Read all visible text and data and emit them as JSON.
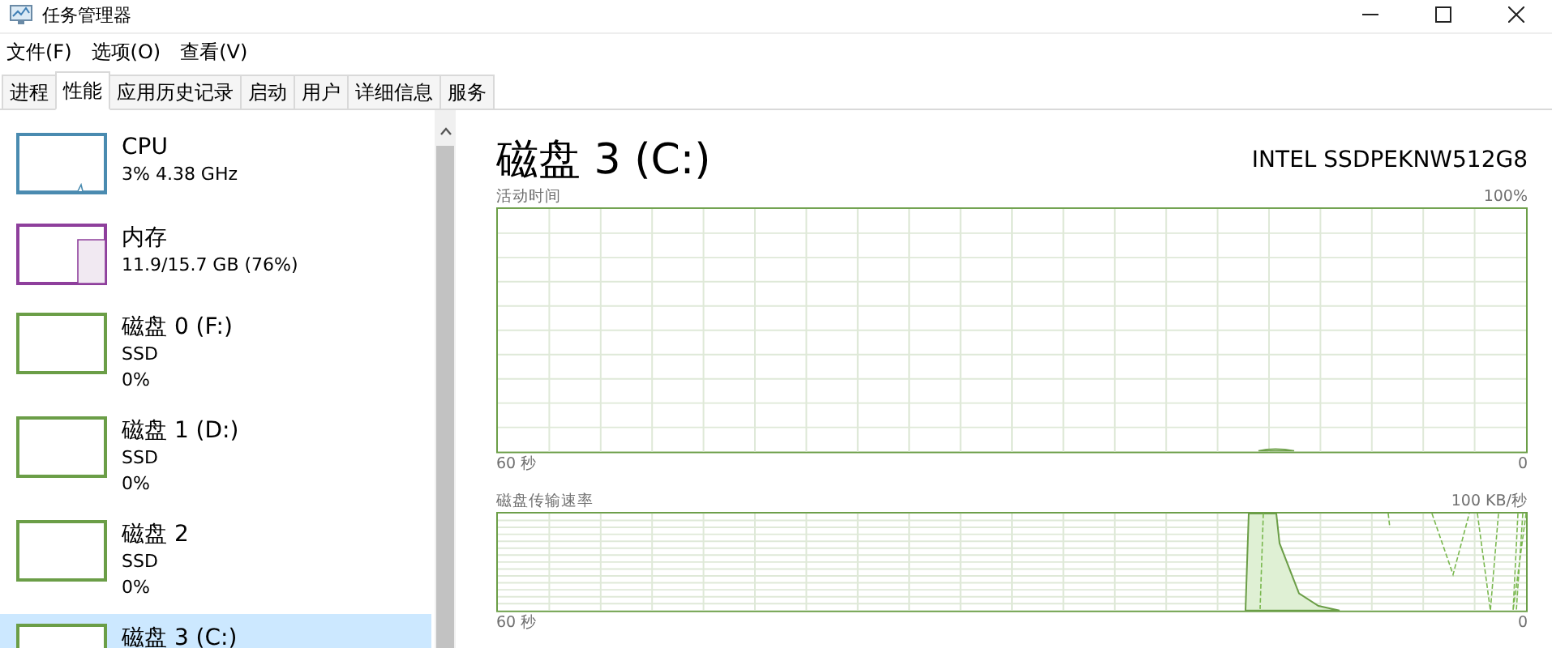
{
  "window": {
    "title": "任务管理器"
  },
  "menu": [
    "文件(F)",
    "选项(O)",
    "查看(V)"
  ],
  "tabs": [
    {
      "label": "进程",
      "selected": false
    },
    {
      "label": "性能",
      "selected": true
    },
    {
      "label": "应用历史记录",
      "selected": false
    },
    {
      "label": "启动",
      "selected": false
    },
    {
      "label": "用户",
      "selected": false
    },
    {
      "label": "详细信息",
      "selected": false
    },
    {
      "label": "服务",
      "selected": false
    }
  ],
  "sidebar": {
    "items": [
      {
        "kind": "cpu",
        "title": "CPU",
        "lines": [
          "3% 4.38 GHz"
        ],
        "color": "#4a8bb0",
        "selected": false
      },
      {
        "kind": "memory",
        "title": "内存",
        "lines": [
          "11.9/15.7 GB (76%)"
        ],
        "color": "#8e3f9c",
        "selected": false
      },
      {
        "kind": "disk",
        "title": "磁盘 0 (F:)",
        "lines": [
          "SSD",
          "0%"
        ],
        "color": "#6b9e47",
        "selected": false
      },
      {
        "kind": "disk",
        "title": "磁盘 1 (D:)",
        "lines": [
          "SSD",
          "0%"
        ],
        "color": "#6b9e47",
        "selected": false
      },
      {
        "kind": "disk",
        "title": "磁盘 2",
        "lines": [
          "SSD",
          "0%"
        ],
        "color": "#6b9e47",
        "selected": false
      },
      {
        "kind": "disk",
        "title": "磁盘 3 (C:)",
        "color": "#6b9e47",
        "selected": true
      }
    ]
  },
  "detail": {
    "title": "磁盘 3 (C:)",
    "model": "INTEL SSDPEKNW512G8",
    "graphs": [
      {
        "kind": "active",
        "label": "活动时间",
        "max": "100%",
        "time": "60 秒",
        "min": "0"
      },
      {
        "kind": "transfer",
        "label": "磁盘传输速率",
        "max": "100 KB/秒",
        "time": "60 秒",
        "min": "0"
      }
    ]
  }
}
